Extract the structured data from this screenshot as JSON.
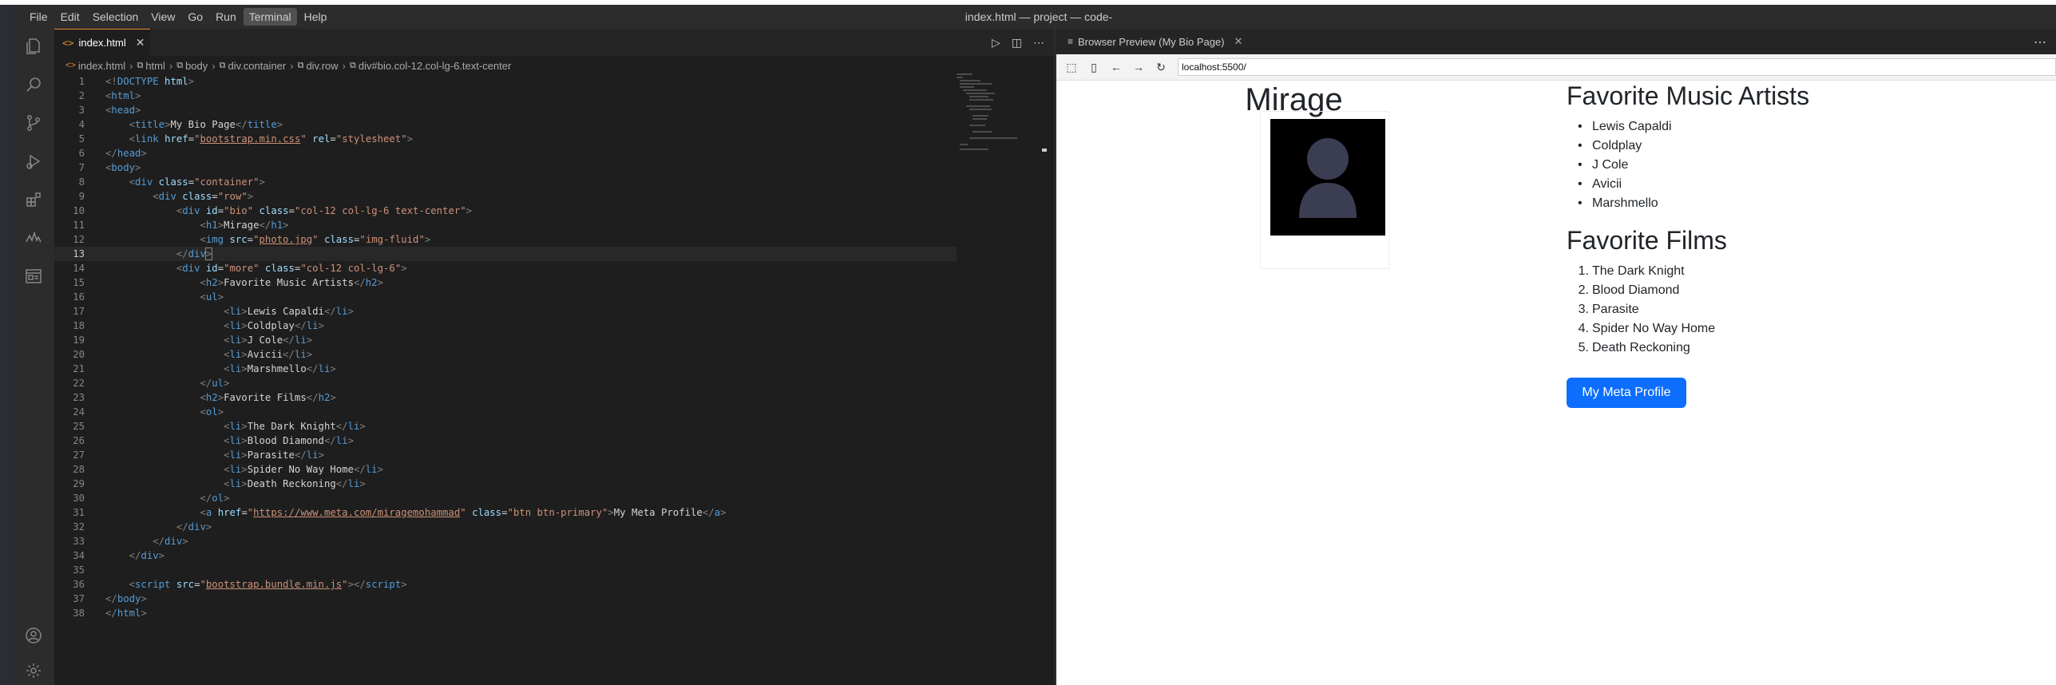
{
  "menu": [
    "File",
    "Edit",
    "Selection",
    "View",
    "Go",
    "Run",
    "Terminal",
    "Help"
  ],
  "menu_active": "Terminal",
  "window_title": "index.html — project — code-server",
  "editor": {
    "tab_label": "index.html",
    "breadcrumb": [
      "index.html",
      "html",
      "body",
      "div.container",
      "div.row",
      "div#bio.col-12.col-lg-6.text-center"
    ],
    "line_numbers": [
      "1",
      "2",
      "3",
      "4",
      "5",
      "6",
      "7",
      "8",
      "9",
      "10",
      "11",
      "12",
      "13",
      "14",
      "15",
      "16",
      "17",
      "18",
      "19",
      "20",
      "21",
      "22",
      "23",
      "24",
      "25",
      "26",
      "27",
      "28",
      "29",
      "30",
      "31",
      "32",
      "33",
      "34",
      "35",
      "36",
      "37",
      "38"
    ],
    "current_line": "13"
  },
  "preview": {
    "tab_label": "Browser Preview (My Bio Page)",
    "address": "localhost:5500/",
    "page": {
      "name": "Mirage",
      "music_heading": "Favorite Music Artists",
      "artists": [
        "Lewis Capaldi",
        "Coldplay",
        "J Cole",
        "Avicii",
        "Marshmello"
      ],
      "films_heading": "Favorite Films",
      "films": [
        "The Dark Knight",
        "Blood Diamond",
        "Parasite",
        "Spider No Way Home",
        "Death Reckoning"
      ],
      "film_numbers": [
        "1.",
        "2.",
        "3.",
        "4.",
        "5."
      ],
      "button_label": "My Meta Profile"
    }
  },
  "colors": {
    "accent": "#0d6efd",
    "tab_accent": "#e38b2c",
    "editor_bg": "#1e1e1e"
  }
}
